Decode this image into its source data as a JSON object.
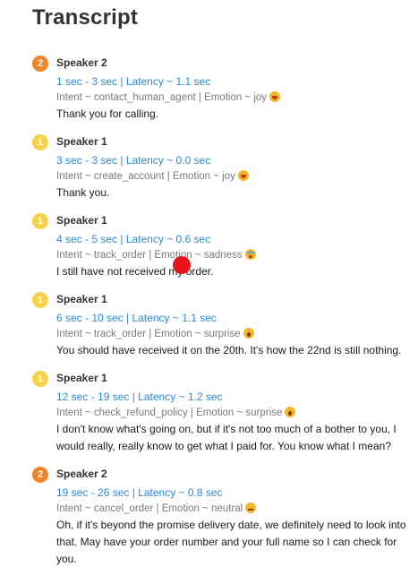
{
  "title": "Transcript",
  "entries": [
    {
      "badge": "2",
      "speaker": "Speaker 2",
      "timing": "1 sec - 3 sec | Latency ~ 1.1 sec",
      "meta": "Intent ~ contact_human_agent | Emotion ~ joy",
      "emotion_icon": "joy-emoji",
      "text": "Thank you for calling."
    },
    {
      "badge": "1",
      "speaker": "Speaker 1",
      "timing": "3 sec - 3 sec | Latency ~ 0.0 sec",
      "meta": "Intent ~ create_account | Emotion ~ joy",
      "emotion_icon": "joy-emoji",
      "text": "Thank you."
    },
    {
      "badge": "1",
      "speaker": "Speaker 1",
      "timing": "4 sec - 5 sec | Latency ~ 0.6 sec",
      "meta": "Intent ~ track_order | Emotion ~ sadness",
      "emotion_icon": "sad-emoji",
      "text": "I still have not received my order."
    },
    {
      "badge": "1",
      "speaker": "Speaker 1",
      "timing": "6 sec - 10 sec | Latency ~ 1.1 sec",
      "meta": "Intent ~ track_order | Emotion ~ surprise",
      "emotion_icon": "surprise-emoji",
      "text": "You should have received it on the 20th. It's how the 22nd is still nothing."
    },
    {
      "badge": "1",
      "speaker": "Speaker 1",
      "timing": "12 sec - 19 sec | Latency ~ 1.2 sec",
      "meta": "Intent ~ check_refund_policy | Emotion ~ surprise",
      "emotion_icon": "surprise-emoji",
      "text": "I don't know what's going on, but if it's not too much of a bother to you, I would really, really know to get what I paid for. You know what I mean?"
    },
    {
      "badge": "2",
      "speaker": "Speaker 2",
      "timing": "19 sec - 26 sec | Latency ~ 0.8 sec",
      "meta": "Intent ~ cancel_order | Emotion ~ neutral",
      "emotion_icon": "neutral-emoji",
      "text": "Oh, if it's beyond the promise delivery date, we definitely need to look into that. May have your order number and your full name so I can check for you."
    }
  ],
  "colors": {
    "speaker1_badge": "#f6d34a",
    "speaker2_badge": "#f0852a",
    "timing_text": "#2b8ae0",
    "meta_text": "#7a7a7a",
    "cursor_dot": "#e8141c"
  }
}
